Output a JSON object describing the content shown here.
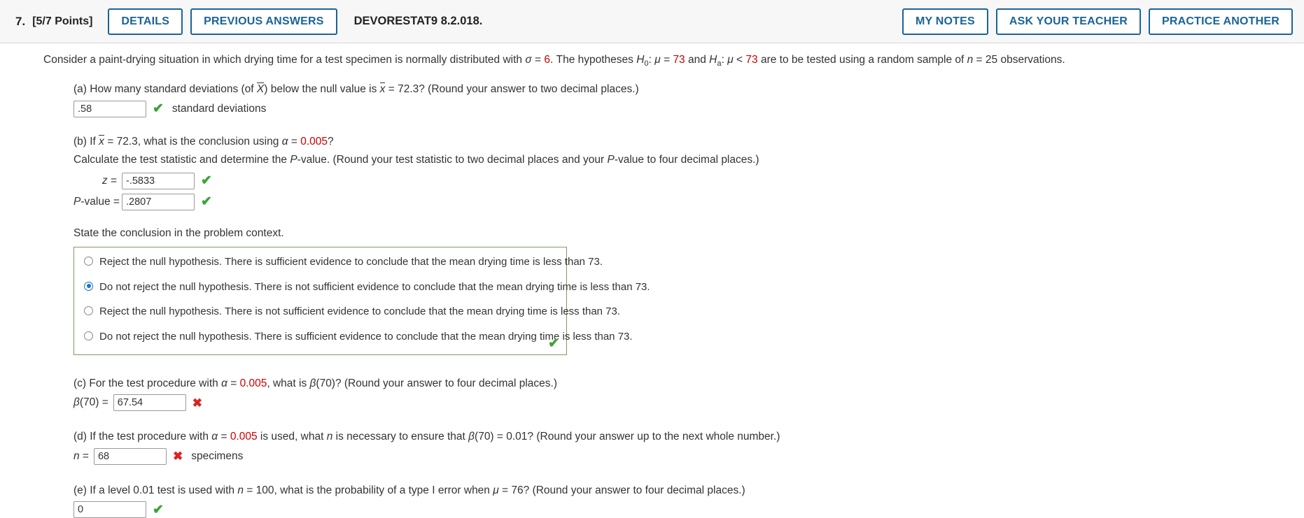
{
  "header": {
    "question_number": "7.",
    "points": "[5/7 Points]",
    "details_label": "DETAILS",
    "previous_answers_label": "PREVIOUS ANSWERS",
    "question_code": "DEVORESTAT9 8.2.018.",
    "my_notes_label": "MY NOTES",
    "ask_your_teacher_label": "ASK YOUR TEACHER",
    "practice_another_label": "PRACTICE ANOTHER",
    "accent_color": "#1a6496"
  },
  "stem": {
    "t1": "Consider a paint-drying situation in which drying time for a test specimen is normally distributed with ",
    "sigma": "σ",
    "eq1": " = ",
    "sigma_value": "6",
    "t2": ". The hypotheses ",
    "h0": "H",
    "h0_sub": "0",
    "t3": ": ",
    "mu": "μ",
    "eq2": " = ",
    "h0_value": "73",
    "t4": " and ",
    "ha": "H",
    "ha_sub": "a",
    "t5": ": ",
    "mu2": "μ",
    "lt": " < ",
    "ha_value": "73",
    "t6": " are to be tested using a random sample of ",
    "n": "n",
    "eq3": " = ",
    "n_value": "25",
    "t7": " observations."
  },
  "part_a": {
    "label_1": "(a) How many standard deviations (of ",
    "xbar_sym": "X",
    "label_2": ") below the null value is ",
    "xbar_sym2": "x",
    "label_3": " = 72.3? (Round your answer to two decimal places.)",
    "answer": ".58",
    "unit_text": "standard deviations",
    "status": "correct"
  },
  "part_b": {
    "label_1": "(b) If ",
    "xbar_sym": "x",
    "label_2": " = 72.3, what is the conclusion using ",
    "alpha": "α",
    "eq": " = ",
    "alpha_value": "0.005",
    "label_3": "?",
    "instruction_1": "Calculate the test statistic and determine the ",
    "instruction_p": "P",
    "instruction_2": "-value. (Round your test statistic to two decimal places and your ",
    "instruction_p2": "P",
    "instruction_3": "-value to four decimal places.)",
    "z_label": "z",
    "z_eq": " = ",
    "z_value": "-.5833",
    "z_status": "correct",
    "p_label": "P",
    "p_label_rest": "-value",
    "p_eq": " = ",
    "p_value": ".2807",
    "p_status": "correct",
    "conclusion_prompt": "State the conclusion in the problem context.",
    "options": [
      {
        "text": "Reject the null hypothesis. There is sufficient evidence to conclude that the mean drying time is less than 73.",
        "selected": false
      },
      {
        "text": "Do not reject the null hypothesis. There is not sufficient evidence to conclude that the mean drying time is less than 73.",
        "selected": true
      },
      {
        "text": "Reject the null hypothesis. There is not sufficient evidence to conclude that the mean drying time is less than 73.",
        "selected": false
      },
      {
        "text": "Do not reject the null hypothesis. There is sufficient evidence to conclude that the mean drying time is less than 73.",
        "selected": false
      }
    ],
    "options_status": "correct"
  },
  "part_c": {
    "label_1": "(c) For the test procedure with ",
    "alpha": "α",
    "eq": " = ",
    "alpha_value": "0.005",
    "label_2": ", what is ",
    "beta": "β",
    "label_3": "(70)? (Round your answer to four decimal places.)",
    "field_beta": "β",
    "field_label": "(70) = ",
    "answer": "67.54",
    "status": "incorrect"
  },
  "part_d": {
    "label_1": "(d) If the test procedure with ",
    "alpha": "α",
    "eq": " = ",
    "alpha_value": "0.005",
    "label_2": " is used, what ",
    "n": "n",
    "label_3": " is necessary to ensure that ",
    "beta": "β",
    "label_4": "(70) = 0.01? (Round your answer up to the next whole number.)",
    "field_n": "n",
    "field_eq": " = ",
    "answer": "68",
    "status": "incorrect",
    "unit_text": "specimens"
  },
  "part_e": {
    "label_1": "(e) If a level 0.01 test is used with ",
    "n": "n",
    "label_2": " = 100, what is the probability of a type I error when ",
    "mu": "μ",
    "label_3": " = 76? (Round your answer to four decimal places.)",
    "answer": "0",
    "status": "correct"
  },
  "icons": {
    "check": "✔",
    "cross": "✖"
  }
}
